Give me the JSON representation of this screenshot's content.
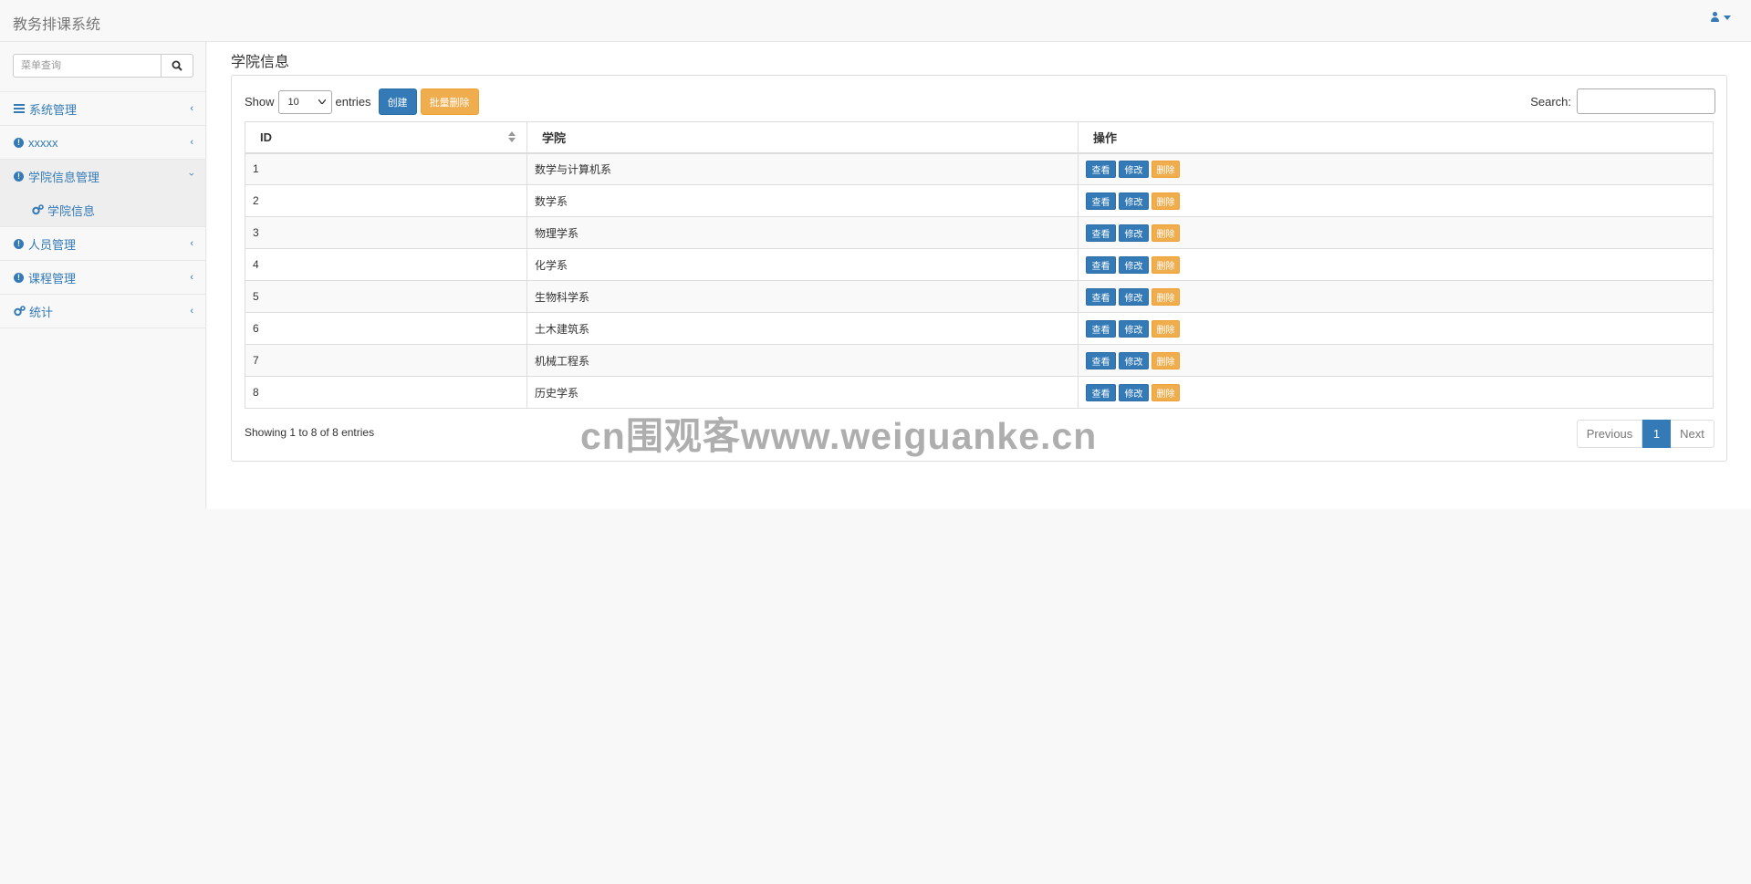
{
  "app": {
    "title": "教务排课系统"
  },
  "sidebar": {
    "search_placeholder": "菜单查询",
    "items": [
      {
        "label": "系统管理",
        "icon": "bars-icon"
      },
      {
        "label": "xxxxx",
        "icon": "info-circle-icon"
      },
      {
        "label": "学院信息管理",
        "icon": "info-circle-icon",
        "expanded": true,
        "children": [
          {
            "label": "学院信息",
            "icon": "gears-icon"
          }
        ]
      },
      {
        "label": "人员管理",
        "icon": "info-circle-icon"
      },
      {
        "label": "课程管理",
        "icon": "info-circle-icon"
      },
      {
        "label": "统计",
        "icon": "gears-icon"
      }
    ]
  },
  "main": {
    "page_title": "学院信息",
    "length": {
      "show": "Show",
      "value": "10",
      "entries": "entries"
    },
    "buttons": {
      "create": "创建",
      "batch_delete": "批量删除"
    },
    "search": {
      "label": "Search:"
    },
    "table": {
      "columns": [
        "ID",
        "学院",
        "操作"
      ],
      "rows": [
        {
          "id": "1",
          "name": "数学与计算机系"
        },
        {
          "id": "2",
          "name": "数学系"
        },
        {
          "id": "3",
          "name": "物理学系"
        },
        {
          "id": "4",
          "name": "化学系"
        },
        {
          "id": "5",
          "name": "生物科学系"
        },
        {
          "id": "6",
          "name": "土木建筑系"
        },
        {
          "id": "7",
          "name": "机械工程系"
        },
        {
          "id": "8",
          "name": "历史学系"
        }
      ],
      "actions": {
        "view": "查看",
        "edit": "修改",
        "delete": "删除"
      }
    },
    "info": "Showing 1 to 8 of 8 entries",
    "pagination": {
      "previous": "Previous",
      "current": "1",
      "next": "Next"
    }
  },
  "watermark": "cn围观客www.weiguanke.cn",
  "colors": {
    "primary": "#337ab7",
    "warning": "#f0ad4e",
    "navbar_bg": "#f8f8f8"
  }
}
